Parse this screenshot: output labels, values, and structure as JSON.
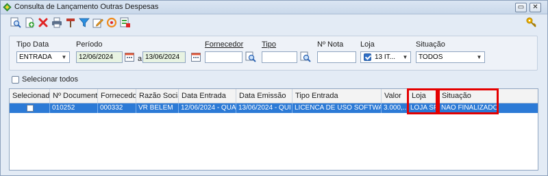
{
  "window": {
    "title": "Consulta de Lançamento Outras Despesas",
    "controls": {
      "restore": "▭",
      "close": "✕"
    }
  },
  "toolbar": {
    "icons": [
      "search-icon",
      "new-document-icon",
      "delete-icon",
      "print-icon",
      "tools-icon",
      "filter-icon",
      "edit-icon",
      "refresh-icon",
      "export-icon"
    ]
  },
  "filters": {
    "tipo_data": {
      "label": "Tipo Data",
      "value": "ENTRADA"
    },
    "periodo": {
      "label": "Período",
      "start": "12/06/2024",
      "separator": "a",
      "end": "13/06/2024"
    },
    "fornecedor": {
      "label": "Fornecedor",
      "value": ""
    },
    "tipo": {
      "label": "Tipo",
      "value": ""
    },
    "nota": {
      "label": "Nº Nota",
      "value": ""
    },
    "loja": {
      "label": "Loja",
      "value": "13 IT..."
    },
    "situacao": {
      "label": "Situação",
      "value": "TODOS"
    }
  },
  "select_all": {
    "label": "Selecionar todos"
  },
  "grid": {
    "columns": [
      "Selecionado",
      "Nº Documento",
      "Fornecedor",
      "Razão Social",
      "Data Entrada",
      "Data Emissão",
      "Tipo Entrada",
      "Valor",
      "Loja",
      "Situação"
    ],
    "rows": [
      {
        "selecionado": "",
        "documento": "010252",
        "fornecedor": "000332",
        "razao_social": "VR BELEM",
        "data_entrada": "12/06/2024 - QUA",
        "data_emissao": "13/06/2024 - QUI",
        "tipo_entrada": "LICENCA DE USO SOFTWARE",
        "valor": "3.000,...",
        "loja": "LOJA SP",
        "situacao": "NAO FINALIZADO"
      }
    ]
  },
  "colors": {
    "selection": "#2c7ad6",
    "highlight": "#e40000",
    "date_field": "#e8f3e2"
  }
}
